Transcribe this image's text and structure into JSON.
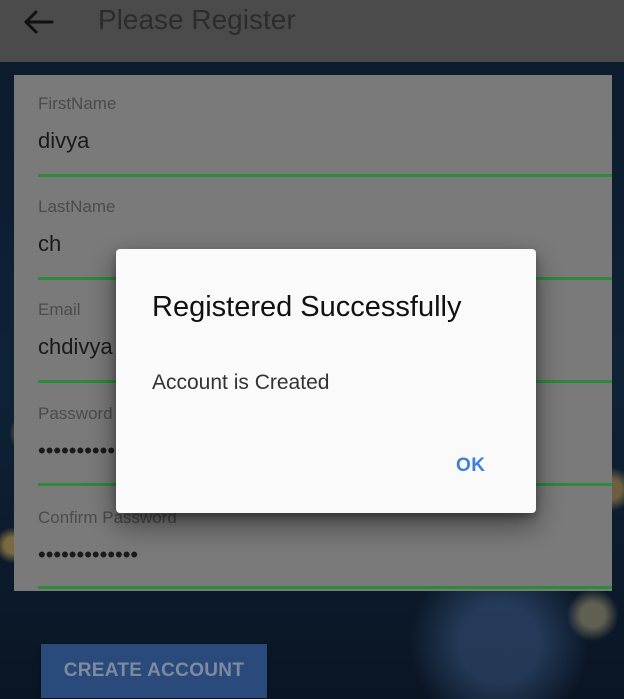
{
  "toolbar": {
    "title": "Please Register"
  },
  "form": {
    "first_name": {
      "label": "FirstName",
      "value": "divya"
    },
    "last_name": {
      "label": "LastName",
      "value": "ch"
    },
    "email": {
      "label": "Email",
      "value": "chdivya"
    },
    "password": {
      "label": "Password",
      "value": "••••••••••"
    },
    "confirm_password": {
      "label": "Confirm Password",
      "value": "•••••••••••••"
    },
    "create_button": "CREATE ACCOUNT"
  },
  "dialog": {
    "title": "Registered Successfully",
    "message": "Account is Created",
    "ok_label": "OK"
  },
  "colors": {
    "accent_line": "#2c8a3a",
    "ok_button": "#3b7fe0",
    "create_button_bg": "#2b4a7c"
  }
}
